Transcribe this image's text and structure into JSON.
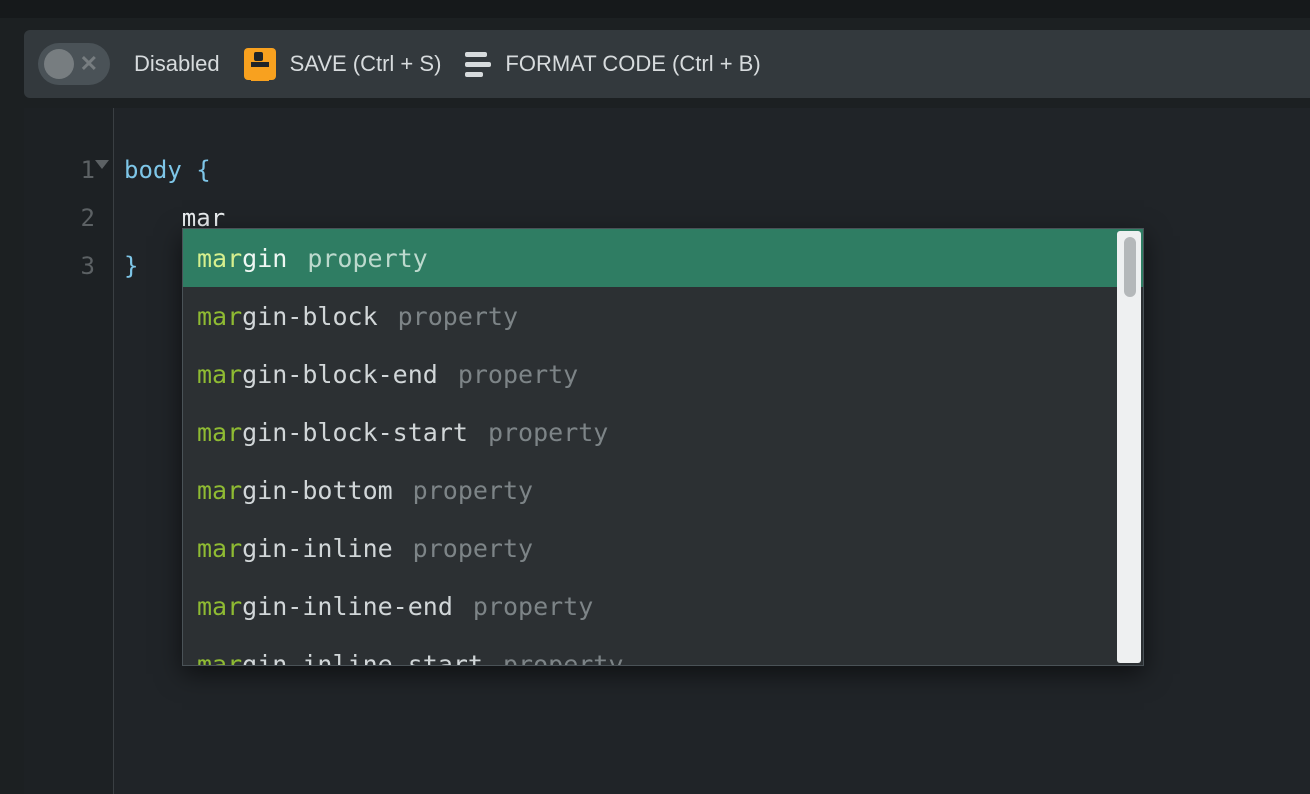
{
  "toolbar": {
    "toggle_state": "off",
    "toggle_label": "Disabled",
    "save_label": "SAVE (Ctrl + S)",
    "format_label": "FORMAT CODE (Ctrl + B)"
  },
  "editor": {
    "lines": [
      "1",
      "2",
      "3"
    ],
    "selector": "body",
    "open_brace": "{",
    "typed": "mar",
    "close_brace": "}"
  },
  "autocomplete": {
    "typed_prefix": "mar",
    "kind_label": "property",
    "items": [
      {
        "match": "mar",
        "rest": "gin",
        "kind": "property",
        "selected": true
      },
      {
        "match": "mar",
        "rest": "gin-block",
        "kind": "property",
        "selected": false
      },
      {
        "match": "mar",
        "rest": "gin-block-end",
        "kind": "property",
        "selected": false
      },
      {
        "match": "mar",
        "rest": "gin-block-start",
        "kind": "property",
        "selected": false
      },
      {
        "match": "mar",
        "rest": "gin-bottom",
        "kind": "property",
        "selected": false
      },
      {
        "match": "mar",
        "rest": "gin-inline",
        "kind": "property",
        "selected": false
      },
      {
        "match": "mar",
        "rest": "gin-inline-end",
        "kind": "property",
        "selected": false
      },
      {
        "match": "mar",
        "rest": "gin-inline-start",
        "kind": "property",
        "selected": false
      }
    ]
  }
}
